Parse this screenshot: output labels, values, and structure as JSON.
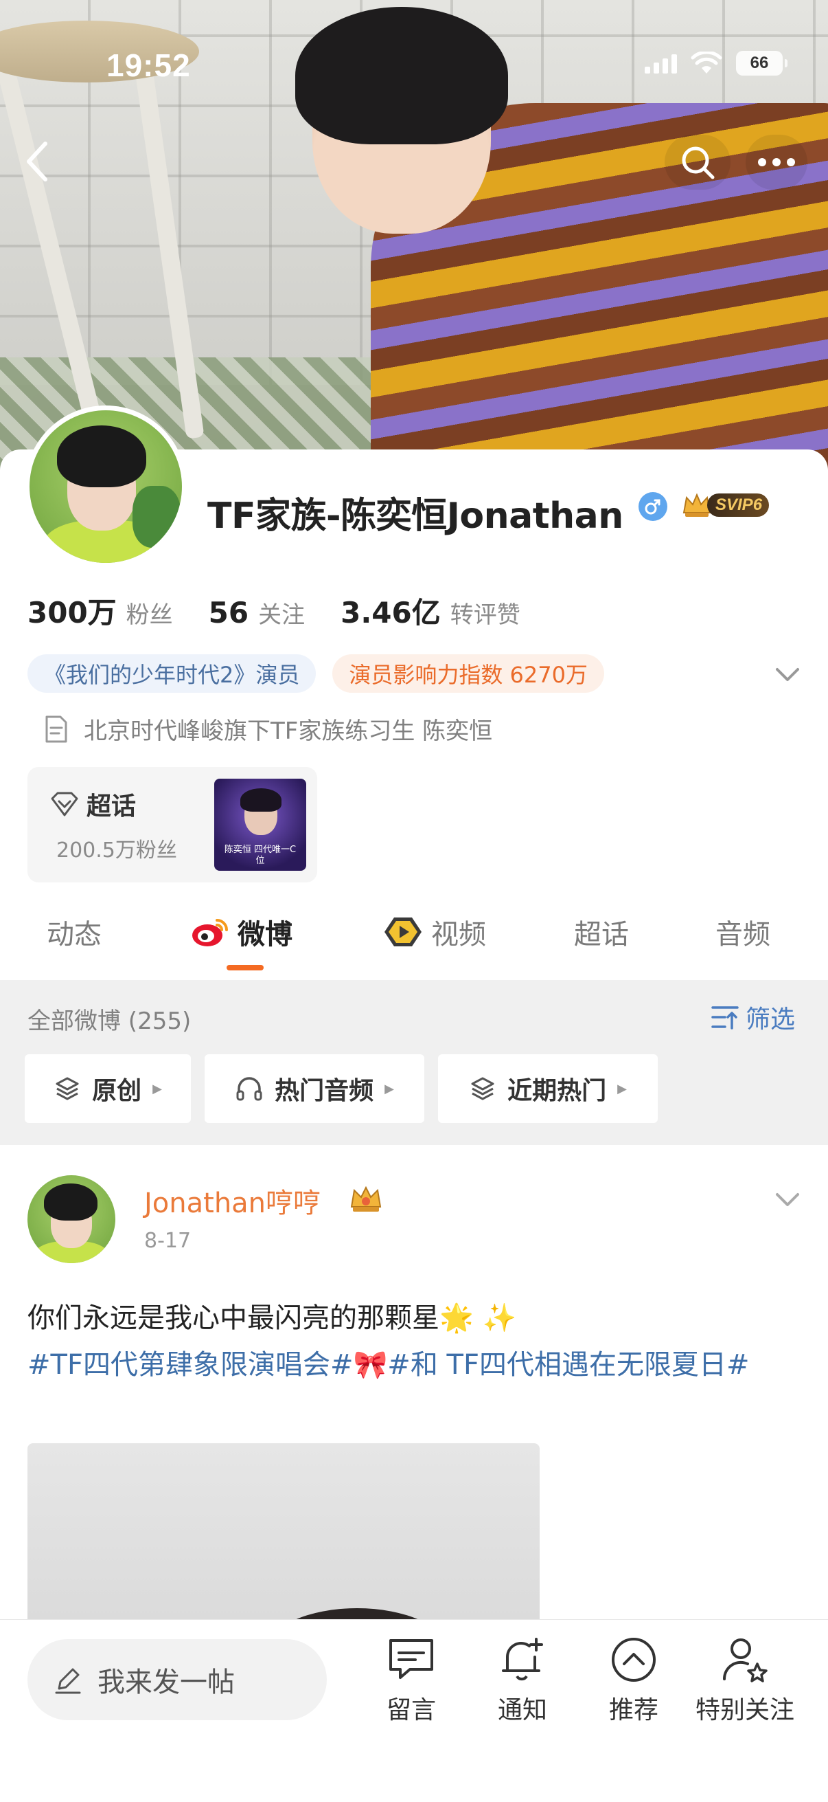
{
  "status_bar": {
    "time": "19:52",
    "battery": "66"
  },
  "profile": {
    "name": "TF家族-陈奕恒Jonathan",
    "vip_badge": "SVIP6",
    "stats": [
      {
        "value": "300万",
        "label": "粉丝"
      },
      {
        "value": "56",
        "label": "关注"
      },
      {
        "value": "3.46亿",
        "label": "转评赞"
      }
    ],
    "tags": [
      {
        "text": "《我们的少年时代2》演员",
        "style": "blue"
      },
      {
        "text": "演员影响力指数 6270万",
        "style": "orange"
      }
    ],
    "bio": "北京时代峰峻旗下TF家族练习生 陈奕恒"
  },
  "supertopic": {
    "title": "超话",
    "subtitle": "200.5万粉丝",
    "thumb_text": "陈奕恒 四代唯一C位"
  },
  "tabs": [
    {
      "label": "动态",
      "icon": null,
      "active": false
    },
    {
      "label": "微博",
      "icon": "weibo-logo-icon",
      "active": true
    },
    {
      "label": "视频",
      "icon": "video-icon",
      "active": false
    },
    {
      "label": "超话",
      "icon": null,
      "active": false
    },
    {
      "label": "音频",
      "icon": null,
      "active": false
    }
  ],
  "filter": {
    "count_label": "全部微博 (255)",
    "filter_button": "筛选",
    "chips": [
      {
        "label": "原创",
        "icon": "layers-icon"
      },
      {
        "label": "热门音频",
        "icon": "headphones-icon"
      },
      {
        "label": "近期热门",
        "icon": "layers-icon"
      }
    ]
  },
  "post": {
    "author": "Jonathan哼哼",
    "date": "8-17",
    "text_line1": "你们永远是我心中最闪亮的那颗星🌟 ✨",
    "hashtag1": "#TF四代第肆象限演唱会#",
    "emoji_bow": "🎀",
    "hashtag2": "#和 TF四代相遇在无限夏日#"
  },
  "bottom_bar": {
    "compose_placeholder": "我来发一帖",
    "items": [
      {
        "label": "留言",
        "icon": "comment-icon"
      },
      {
        "label": "通知",
        "icon": "bell-plus-icon"
      },
      {
        "label": "推荐",
        "icon": "chevron-up-circle-icon"
      },
      {
        "label": "特别关注",
        "icon": "user-star-icon"
      }
    ]
  },
  "colors": {
    "accent_orange": "#f46a22",
    "link_blue": "#3d6ea8",
    "filter_blue": "#4a7cc0"
  }
}
